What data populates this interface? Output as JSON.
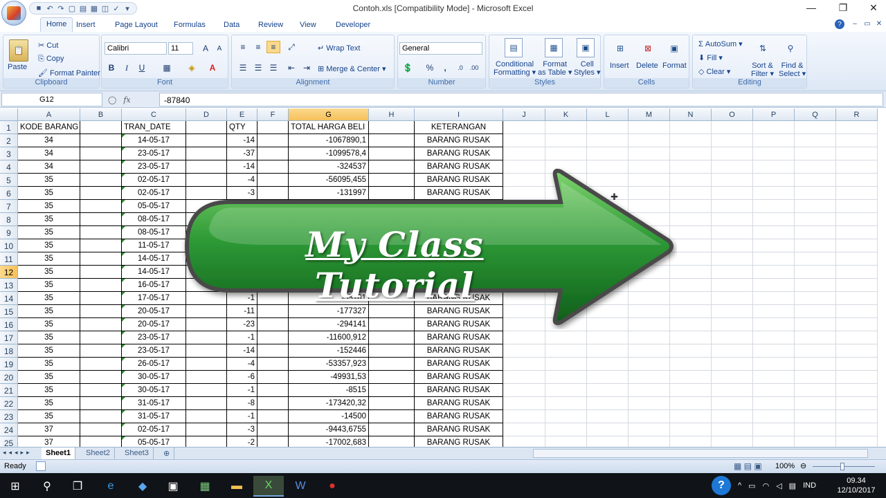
{
  "window": {
    "title": "Contoh.xls  [Compatibility Mode] - Microsoft Excel"
  },
  "tabs": [
    "Home",
    "Insert",
    "Page Layout",
    "Formulas",
    "Data",
    "Review",
    "View",
    "Developer"
  ],
  "ribbon": {
    "clipboard": {
      "paste": "Paste",
      "cut": "Cut",
      "copy": "Copy",
      "format_painter": "Format Painter",
      "group": "Clipboard"
    },
    "font": {
      "name": "Calibri",
      "size": "11",
      "group": "Font",
      "bold": "B",
      "italic": "I",
      "underline": "U"
    },
    "alignment": {
      "wrap": "Wrap Text",
      "merge": "Merge & Center",
      "group": "Alignment"
    },
    "number": {
      "format": "General",
      "group": "Number",
      "percent": "%",
      "comma": ","
    },
    "styles": {
      "conditional": [
        "Conditional",
        "Formatting"
      ],
      "format_table": [
        "Format",
        "as Table"
      ],
      "cell_styles": [
        "Cell",
        "Styles"
      ],
      "group": "Styles"
    },
    "cells": {
      "insert": "Insert",
      "delete": "Delete",
      "format": "Format",
      "group": "Cells"
    },
    "editing": {
      "autosum": "AutoSum",
      "fill": "Fill",
      "clear": "Clear",
      "sort": [
        "Sort &",
        "Filter"
      ],
      "find": [
        "Find &",
        "Select"
      ],
      "group": "Editing"
    }
  },
  "formula_bar": {
    "name_box": "G12",
    "fx": "fx",
    "value": "-87840"
  },
  "columns": [
    "A",
    "B",
    "C",
    "D",
    "E",
    "F",
    "G",
    "H",
    "I",
    "J",
    "K",
    "L",
    "M",
    "N",
    "O",
    "P",
    "Q",
    "R"
  ],
  "row_numbers": [
    "1",
    "2",
    "3",
    "4",
    "5",
    "6",
    "7",
    "8",
    "9",
    "10",
    "11",
    "12",
    "13",
    "14",
    "15",
    "16",
    "17",
    "18",
    "19",
    "20",
    "21",
    "22",
    "23",
    "24",
    "25"
  ],
  "header_row": {
    "a": "KODE BARANG",
    "c": "TRAN_DATE",
    "e": "QTY",
    "g": "TOTAL HARGA BELI",
    "i": "KETERANGAN"
  },
  "rows": [
    {
      "kode": "34",
      "date": "14-05-17",
      "qty": "-14",
      "total": "-1067890,1",
      "ket": "BARANG RUSAK"
    },
    {
      "kode": "34",
      "date": "23-05-17",
      "qty": "-37",
      "total": "-1099578,4",
      "ket": "BARANG RUSAK"
    },
    {
      "kode": "34",
      "date": "23-05-17",
      "qty": "-14",
      "total": "-324537",
      "ket": "BARANG RUSAK"
    },
    {
      "kode": "35",
      "date": "02-05-17",
      "qty": "-4",
      "total": "-56095,455",
      "ket": "BARANG RUSAK"
    },
    {
      "kode": "35",
      "date": "02-05-17",
      "qty": "-3",
      "total": "-131997",
      "ket": "BARANG RUSAK"
    },
    {
      "kode": "35",
      "date": "05-05-17",
      "qty": "",
      "total": "",
      "ket": ""
    },
    {
      "kode": "35",
      "date": "08-05-17",
      "qty": "",
      "total": "",
      "ket": ""
    },
    {
      "kode": "35",
      "date": "08-05-17",
      "qty": "",
      "total": "",
      "ket": ""
    },
    {
      "kode": "35",
      "date": "11-05-17",
      "qty": "",
      "total": "",
      "ket": ""
    },
    {
      "kode": "35",
      "date": "14-05-17",
      "qty": "",
      "total": "",
      "ket": ""
    },
    {
      "kode": "35",
      "date": "14-05-17",
      "qty": "",
      "total": "",
      "ket": ""
    },
    {
      "kode": "35",
      "date": "16-05-17",
      "qty": "",
      "total": "",
      "ket": ""
    },
    {
      "kode": "35",
      "date": "17-05-17",
      "qty": "-1",
      "total": "-35181",
      "ket": "BARANG RUSAK"
    },
    {
      "kode": "35",
      "date": "20-05-17",
      "qty": "-11",
      "total": "-177327",
      "ket": "BARANG RUSAK"
    },
    {
      "kode": "35",
      "date": "20-05-17",
      "qty": "-23",
      "total": "-294141",
      "ket": "BARANG RUSAK"
    },
    {
      "kode": "35",
      "date": "23-05-17",
      "qty": "-1",
      "total": "-11600,912",
      "ket": "BARANG RUSAK"
    },
    {
      "kode": "35",
      "date": "23-05-17",
      "qty": "-14",
      "total": "-152446",
      "ket": "BARANG RUSAK"
    },
    {
      "kode": "35",
      "date": "26-05-17",
      "qty": "-4",
      "total": "-53357,923",
      "ket": "BARANG RUSAK"
    },
    {
      "kode": "35",
      "date": "30-05-17",
      "qty": "-6",
      "total": "-49931,53",
      "ket": "BARANG RUSAK"
    },
    {
      "kode": "35",
      "date": "30-05-17",
      "qty": "-1",
      "total": "-8515",
      "ket": "BARANG RUSAK"
    },
    {
      "kode": "35",
      "date": "31-05-17",
      "qty": "-8",
      "total": "-173420,32",
      "ket": "BARANG RUSAK"
    },
    {
      "kode": "35",
      "date": "31-05-17",
      "qty": "-1",
      "total": "-14500",
      "ket": "BARANG RUSAK"
    },
    {
      "kode": "37",
      "date": "02-05-17",
      "qty": "-3",
      "total": "-9443,6755",
      "ket": "BARANG RUSAK"
    },
    {
      "kode": "37",
      "date": "05-05-17",
      "qty": "-2",
      "total": "-17002,683",
      "ket": "BARANG RUSAK"
    }
  ],
  "sheets": [
    "Sheet1",
    "Sheet2",
    "Sheet3"
  ],
  "status": {
    "ready": "Ready",
    "zoom": "100%"
  },
  "overlay": {
    "text": "My Class Tutorial"
  },
  "taskbar": {
    "lang": "IND",
    "time": "09.34",
    "date": "12/10/2017"
  },
  "colors": {
    "accent": "#15428b",
    "arrow_green": "#2e9a36",
    "selected_header": "#f6c05a"
  }
}
